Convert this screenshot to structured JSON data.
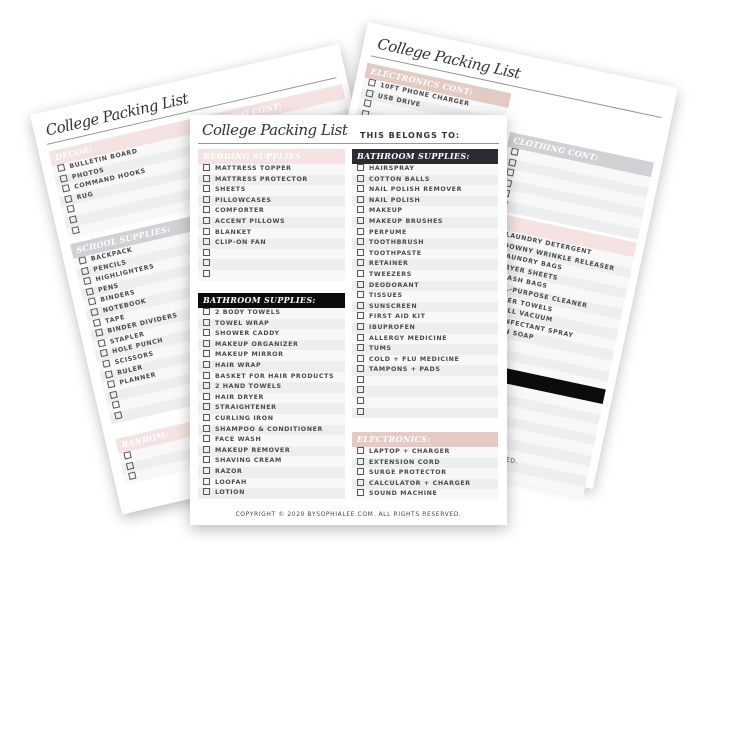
{
  "left_page": {
    "title": "College Packing List",
    "sections": [
      {
        "key": "decor",
        "header": "DECOR:",
        "style": "pink",
        "items": [
          "BULLETIN BOARD",
          "PHOTOS",
          "COMMAND HOOKS",
          "RUG",
          "",
          "",
          ""
        ]
      },
      {
        "key": "school",
        "header": "SCHOOL SUPPLIES:",
        "style": "gray",
        "items": [
          "BACKPACK",
          "PENCILS",
          "HIGHLIGHTERS",
          "PENS",
          "BINDERS",
          "NOTEBOOK",
          "TAPE",
          "BINDER DIVIDERS",
          "STAPLER",
          "HOLE PUNCH",
          "SCISSORS",
          "RULER",
          "PLANNER",
          "",
          "",
          ""
        ]
      },
      {
        "key": "random",
        "header": "RANDOM:",
        "style": "pink",
        "items": [
          "",
          "",
          ""
        ]
      },
      {
        "key": "random-cont",
        "header": "RANDOM CONT:",
        "style": "pink",
        "items": [
          "",
          "",
          "",
          "",
          "",
          "",
          "",
          "",
          "",
          "",
          ""
        ]
      }
    ]
  },
  "right_page": {
    "title": "College Packing List",
    "sections": [
      {
        "key": "electronics-cont",
        "header": "ELECTRONICS CONT:",
        "style": "beige",
        "items": [
          "10FT PHONE CHARGER",
          "USB DRIVE",
          "",
          ""
        ]
      },
      {
        "key": "clothing-cont",
        "header": "CLOTHING CONT:",
        "style": "gray",
        "items": [
          "",
          "",
          "",
          "",
          "",
          ""
        ]
      },
      {
        "key": "cleaning",
        "header": "",
        "style": "pink",
        "items": [
          "LAUNDRY DETERGENT",
          "DOWNY WRINKLE RELEASER",
          "LAUNDRY BAGS",
          "DRYER SHEETS",
          "TRASH BAGS",
          "ALL-PURPOSE CLEANER",
          "PAPER TOWELS",
          "SMALL VACUUM",
          "DISINFECTANT SPRAY",
          "DAWN SOAP",
          "",
          "",
          ""
        ]
      },
      {
        "key": "storage",
        "header": "",
        "style": "black",
        "items": [
          "TORAGE",
          "",
          "ATES",
          "",
          "GS",
          "VERWARE",
          "TLE",
          "",
          ""
        ]
      }
    ],
    "copyright": "RESERVED."
  },
  "front_page": {
    "title": "College Packing List",
    "belongs_to": "THIS BELONGS TO:",
    "sections": [
      {
        "key": "bedding",
        "header": "BEDDING SUPPLIES",
        "style": "pink",
        "items": [
          "MATTRESS TOPPER",
          "MATTRESS PROTECTOR",
          "SHEETS",
          "PILLOWCASES",
          "COMFORTER",
          "ACCENT PILLOWS",
          "BLANKET",
          "CLIP-ON FAN",
          "",
          "",
          ""
        ]
      },
      {
        "key": "bathroom-left",
        "header": "BATHROOM SUPPLIES:",
        "style": "black",
        "items": [
          "2 BODY TOWELS",
          "TOWEL WRAP",
          "SHOWER CADDY",
          "MAKEUP ORGANIZER",
          "MAKEUP MIRROR",
          "HAIR WRAP",
          "BASKET FOR HAIR PRODUCTS",
          "2 HAND TOWELS",
          "HAIR DRYER",
          "STRAIGHTENER",
          "CURLING IRON",
          "SHAMPOO & CONDITIONER",
          "FACE WASH",
          "MAKEUP REMOVER",
          "SHAVING CREAM",
          "RAZOR",
          "LOOFAH",
          "LOTION"
        ]
      },
      {
        "key": "bathroom-right",
        "header": "BATHROOM SUPPLIES:",
        "style": "dark",
        "items": [
          "HAIRSPRAY",
          "COTTON BALLS",
          "NAIL POLISH REMOVER",
          "NAIL POLISH",
          "MAKEUP",
          "MAKEUP BRUSHES",
          "PERFUME",
          "TOOTHBRUSH",
          "TOOTHPASTE",
          "RETAINER",
          "TWEEZERS",
          "DEODORANT",
          "TISSUES",
          "SUNSCREEN",
          "FIRST AID KIT",
          "IBUPROFEN",
          "ALLERGY MEDICINE",
          "TUMS",
          "COLD + FLU MEDICINE",
          "TAMPONS + PADS",
          "",
          "",
          "",
          ""
        ]
      },
      {
        "key": "electronics",
        "header": "ELECTRONICS:",
        "style": "beige",
        "items": [
          "LAPTOP + CHARGER",
          "EXTENSION CORD",
          "SURGE PROTECTOR",
          "CALCULATOR + CHARGER",
          "SOUND MACHINE"
        ]
      }
    ],
    "copyright": "COPYRIGHT © 2020 BYSOPHIALEE.COM. ALL RIGHTS RESERVED."
  },
  "colors": {
    "pink": "#f5e3e3",
    "beige": "#e3cbc3",
    "dark": "#2b2c31",
    "black": "#0c0c0c",
    "gray": "#cfd1d4"
  }
}
